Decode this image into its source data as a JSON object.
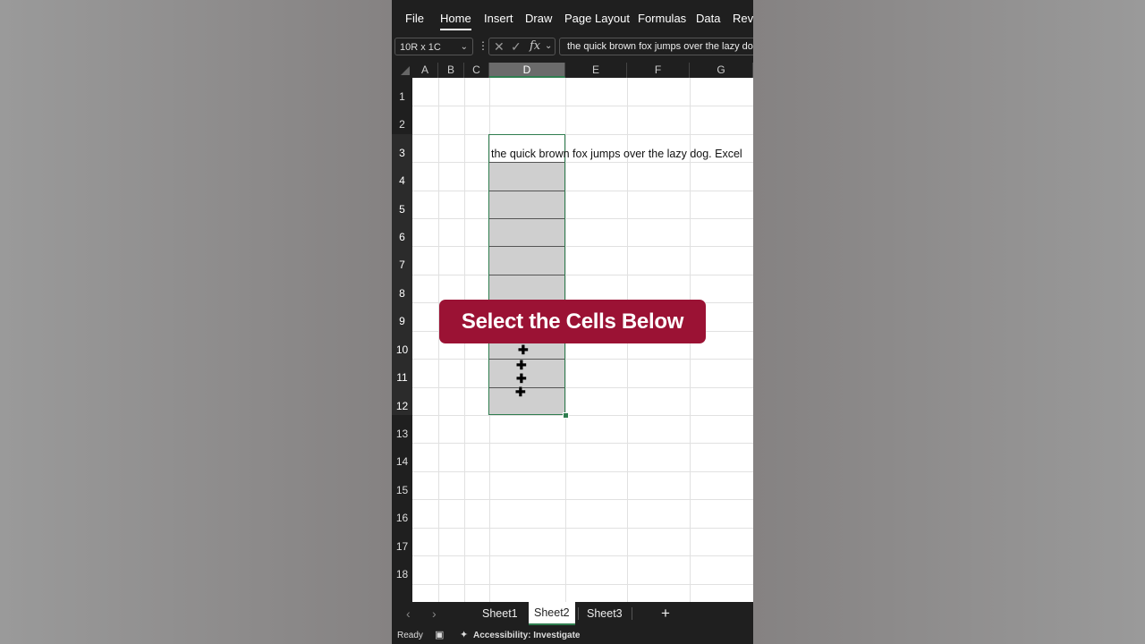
{
  "ribbon": {
    "tabs": [
      "File",
      "Home",
      "Insert",
      "Draw",
      "Page Layout",
      "Formulas",
      "Data",
      "Revi"
    ],
    "active": "Home"
  },
  "formula_bar": {
    "name_box": "10R x 1C",
    "formula": "the quick brown fox jumps over the lazy dog. Excel"
  },
  "grid": {
    "columns": [
      "A",
      "B",
      "C",
      "D",
      "E",
      "F",
      "G"
    ],
    "selected_column": "D",
    "rows": [
      "1",
      "2",
      "3",
      "4",
      "5",
      "6",
      "7",
      "8",
      "9",
      "10",
      "11",
      "12",
      "13",
      "14",
      "15",
      "16",
      "17",
      "18"
    ],
    "cell_d3": "the quick brown fox jumps over the lazy dog. Excel"
  },
  "overlay": {
    "caption": "Select the Cells Below"
  },
  "sheets": {
    "tabs": [
      "Sheet1",
      "Sheet2",
      "Sheet3"
    ],
    "active": "Sheet2",
    "add_label": "+"
  },
  "status": {
    "ready": "Ready",
    "accessibility": "Accessibility: Investigate"
  },
  "colors": {
    "selection_border": "#2f7d4f",
    "caption_bg": "#9b1234",
    "chrome": "#1f1f1f"
  }
}
